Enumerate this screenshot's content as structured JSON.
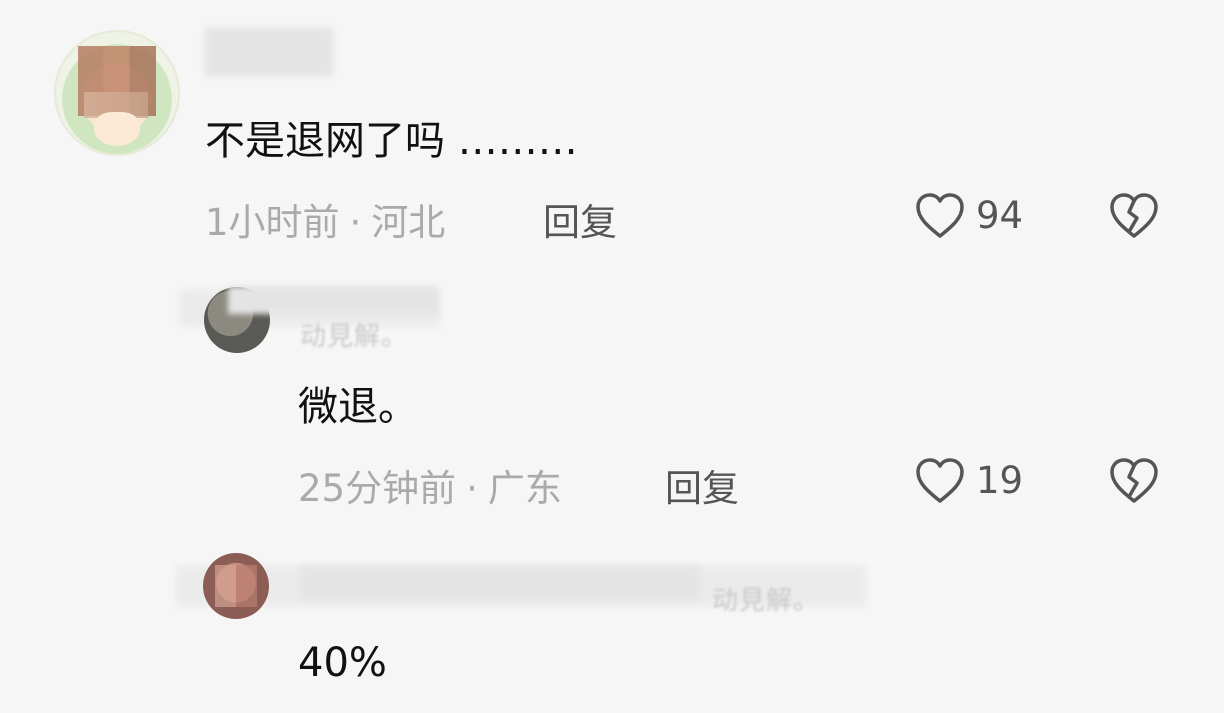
{
  "comments": [
    {
      "text": "不是退网了吗 ………",
      "time": "1小时前",
      "location": "河北",
      "reply_label": "回复",
      "likes": "94"
    },
    {
      "reply_to_tail": "动見解。",
      "text": "微退。",
      "time": "25分钟前",
      "location": "广东",
      "reply_label": "回复",
      "likes": "19"
    },
    {
      "reply_to_tail": "动見解。",
      "text": "40%"
    }
  ],
  "separator": "·",
  "icons": {
    "like": "heart-outline-icon",
    "dislike": "broken-heart-icon"
  },
  "colors": {
    "background": "#f6f6f6",
    "text": "#111111",
    "meta": "#aaaaaa",
    "action": "#555555"
  }
}
